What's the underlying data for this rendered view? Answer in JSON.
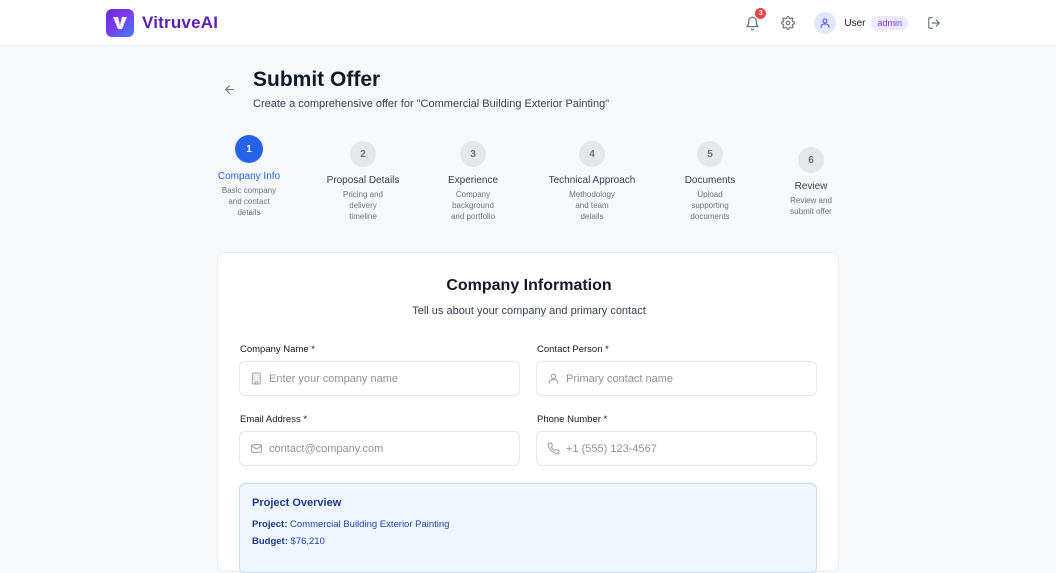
{
  "app": {
    "name": "VitruveAI"
  },
  "nav": {
    "notification_count": "3",
    "user_label": "User",
    "role": "admin"
  },
  "header": {
    "title": "Submit Offer",
    "subtitle": "Create a comprehensive offer for \"Commercial Building Exterior Painting\""
  },
  "steps": [
    {
      "num": "1",
      "title": "Company Info",
      "desc": "Basic company and contact details",
      "active": true
    },
    {
      "num": "2",
      "title": "Proposal Details",
      "desc": "Pricing and delivery timeline",
      "active": false
    },
    {
      "num": "3",
      "title": "Experience",
      "desc": "Company background and portfolio",
      "active": false
    },
    {
      "num": "4",
      "title": "Technical Approach",
      "desc": "Methodology and team details",
      "active": false
    },
    {
      "num": "5",
      "title": "Documents",
      "desc": "Upload supporting documents",
      "active": false
    },
    {
      "num": "6",
      "title": "Review",
      "desc": "Review and submit offer",
      "active": false
    }
  ],
  "form": {
    "title": "Company Information",
    "subtitle": "Tell us about your company and primary contact",
    "company_name": {
      "label": "Company Name *",
      "placeholder": "Enter your company name",
      "icon": "building-icon"
    },
    "contact_person": {
      "label": "Contact Person *",
      "placeholder": "Primary contact name",
      "icon": "user-icon"
    },
    "email": {
      "label": "Email Address *",
      "placeholder": "contact@company.com",
      "icon": "mail-icon"
    },
    "phone": {
      "label": "Phone Number *",
      "placeholder": "+1 (555) 123-4567",
      "icon": "phone-icon"
    }
  },
  "overview": {
    "title": "Project Overview",
    "project_label": "Project:",
    "project_value": "Commercial Building Exterior Painting",
    "budget_label": "Budget:",
    "budget_value": "$76,210"
  },
  "colors": {
    "brand": "#5b21b6",
    "accent": "#2563eb",
    "badge": "#ef4444"
  }
}
